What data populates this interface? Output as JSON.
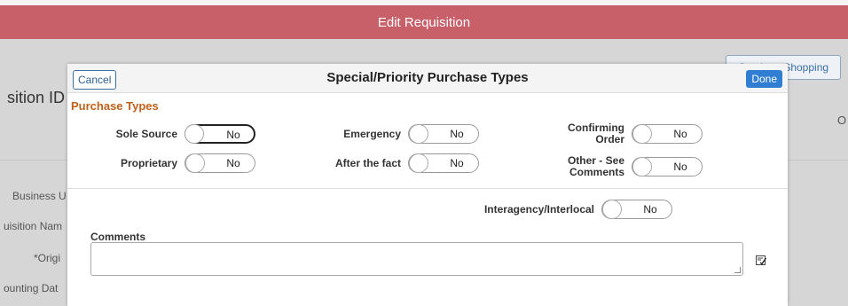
{
  "page": {
    "header_title": "Edit Requisition",
    "continue_button": "Continue Shopping",
    "requisition_id_label": "sition ID",
    "right_partial": "O",
    "side_labels": [
      "Business U",
      "uisition Nam",
      "*Origi",
      "ounting Dat"
    ]
  },
  "modal": {
    "title": "Special/Priority Purchase Types",
    "cancel_label": "Cancel",
    "done_label": "Done",
    "section_title": "Purchase Types",
    "fields": {
      "sole_source": {
        "label": "Sole Source",
        "value": "No"
      },
      "proprietary": {
        "label": "Proprietary",
        "value": "No"
      },
      "emergency": {
        "label": "Emergency",
        "value": "No"
      },
      "after_the_fact": {
        "label": "After the fact",
        "value": "No"
      },
      "confirming_order": {
        "label": "Confirming Order",
        "value": "No"
      },
      "other_see_comments": {
        "label": "Other - See Comments",
        "value": "No"
      },
      "interagency": {
        "label": "Interagency/Interlocal",
        "value": "No"
      }
    },
    "comments_label": "Comments",
    "comments_value": "",
    "spell_check_icon": "spell-check-icon"
  }
}
